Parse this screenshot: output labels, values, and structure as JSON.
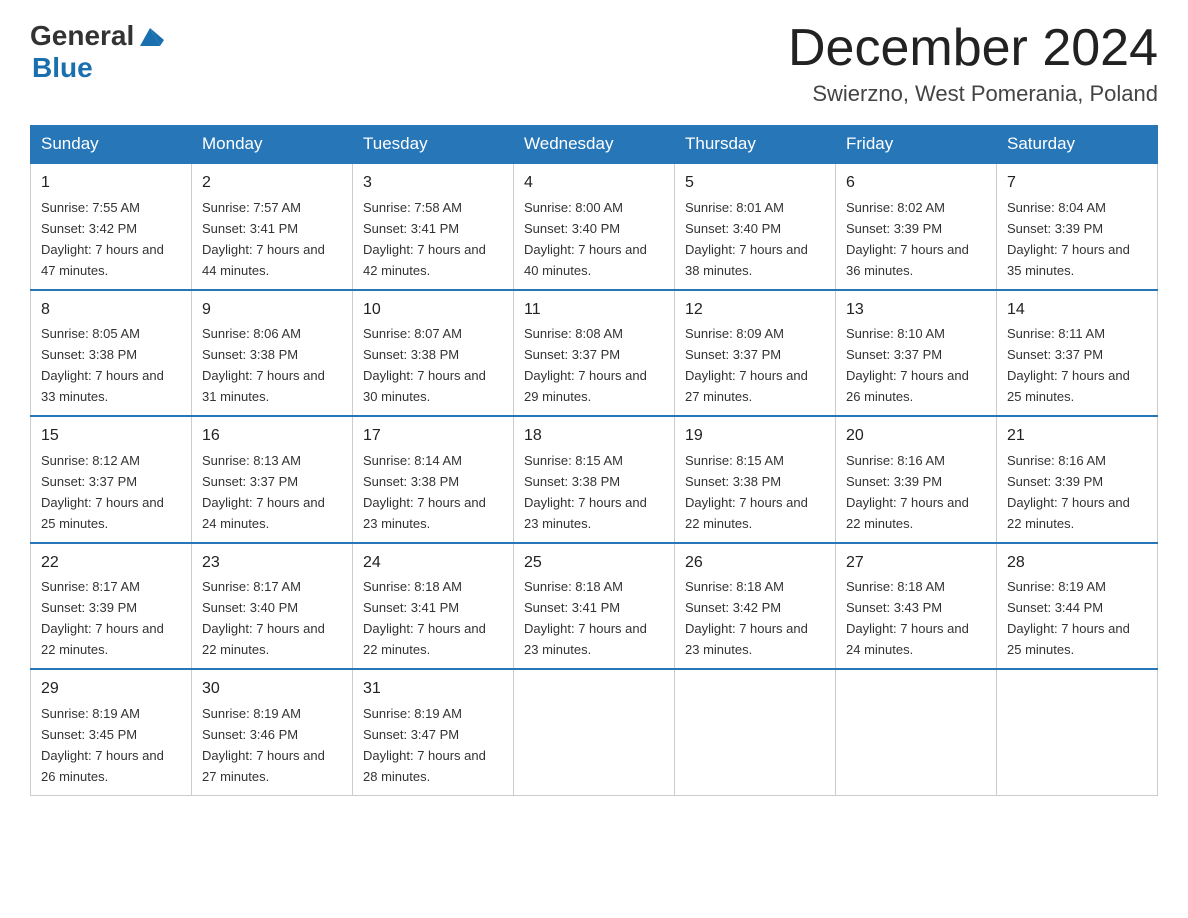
{
  "header": {
    "logo_general": "General",
    "logo_blue": "Blue",
    "month_title": "December 2024",
    "location": "Swierzno, West Pomerania, Poland"
  },
  "days_of_week": [
    "Sunday",
    "Monday",
    "Tuesday",
    "Wednesday",
    "Thursday",
    "Friday",
    "Saturday"
  ],
  "weeks": [
    [
      {
        "day": "1",
        "sunrise": "7:55 AM",
        "sunset": "3:42 PM",
        "daylight": "7 hours and 47 minutes."
      },
      {
        "day": "2",
        "sunrise": "7:57 AM",
        "sunset": "3:41 PM",
        "daylight": "7 hours and 44 minutes."
      },
      {
        "day": "3",
        "sunrise": "7:58 AM",
        "sunset": "3:41 PM",
        "daylight": "7 hours and 42 minutes."
      },
      {
        "day": "4",
        "sunrise": "8:00 AM",
        "sunset": "3:40 PM",
        "daylight": "7 hours and 40 minutes."
      },
      {
        "day": "5",
        "sunrise": "8:01 AM",
        "sunset": "3:40 PM",
        "daylight": "7 hours and 38 minutes."
      },
      {
        "day": "6",
        "sunrise": "8:02 AM",
        "sunset": "3:39 PM",
        "daylight": "7 hours and 36 minutes."
      },
      {
        "day": "7",
        "sunrise": "8:04 AM",
        "sunset": "3:39 PM",
        "daylight": "7 hours and 35 minutes."
      }
    ],
    [
      {
        "day": "8",
        "sunrise": "8:05 AM",
        "sunset": "3:38 PM",
        "daylight": "7 hours and 33 minutes."
      },
      {
        "day": "9",
        "sunrise": "8:06 AM",
        "sunset": "3:38 PM",
        "daylight": "7 hours and 31 minutes."
      },
      {
        "day": "10",
        "sunrise": "8:07 AM",
        "sunset": "3:38 PM",
        "daylight": "7 hours and 30 minutes."
      },
      {
        "day": "11",
        "sunrise": "8:08 AM",
        "sunset": "3:37 PM",
        "daylight": "7 hours and 29 minutes."
      },
      {
        "day": "12",
        "sunrise": "8:09 AM",
        "sunset": "3:37 PM",
        "daylight": "7 hours and 27 minutes."
      },
      {
        "day": "13",
        "sunrise": "8:10 AM",
        "sunset": "3:37 PM",
        "daylight": "7 hours and 26 minutes."
      },
      {
        "day": "14",
        "sunrise": "8:11 AM",
        "sunset": "3:37 PM",
        "daylight": "7 hours and 25 minutes."
      }
    ],
    [
      {
        "day": "15",
        "sunrise": "8:12 AM",
        "sunset": "3:37 PM",
        "daylight": "7 hours and 25 minutes."
      },
      {
        "day": "16",
        "sunrise": "8:13 AM",
        "sunset": "3:37 PM",
        "daylight": "7 hours and 24 minutes."
      },
      {
        "day": "17",
        "sunrise": "8:14 AM",
        "sunset": "3:38 PM",
        "daylight": "7 hours and 23 minutes."
      },
      {
        "day": "18",
        "sunrise": "8:15 AM",
        "sunset": "3:38 PM",
        "daylight": "7 hours and 23 minutes."
      },
      {
        "day": "19",
        "sunrise": "8:15 AM",
        "sunset": "3:38 PM",
        "daylight": "7 hours and 22 minutes."
      },
      {
        "day": "20",
        "sunrise": "8:16 AM",
        "sunset": "3:39 PM",
        "daylight": "7 hours and 22 minutes."
      },
      {
        "day": "21",
        "sunrise": "8:16 AM",
        "sunset": "3:39 PM",
        "daylight": "7 hours and 22 minutes."
      }
    ],
    [
      {
        "day": "22",
        "sunrise": "8:17 AM",
        "sunset": "3:39 PM",
        "daylight": "7 hours and 22 minutes."
      },
      {
        "day": "23",
        "sunrise": "8:17 AM",
        "sunset": "3:40 PM",
        "daylight": "7 hours and 22 minutes."
      },
      {
        "day": "24",
        "sunrise": "8:18 AM",
        "sunset": "3:41 PM",
        "daylight": "7 hours and 22 minutes."
      },
      {
        "day": "25",
        "sunrise": "8:18 AM",
        "sunset": "3:41 PM",
        "daylight": "7 hours and 23 minutes."
      },
      {
        "day": "26",
        "sunrise": "8:18 AM",
        "sunset": "3:42 PM",
        "daylight": "7 hours and 23 minutes."
      },
      {
        "day": "27",
        "sunrise": "8:18 AM",
        "sunset": "3:43 PM",
        "daylight": "7 hours and 24 minutes."
      },
      {
        "day": "28",
        "sunrise": "8:19 AM",
        "sunset": "3:44 PM",
        "daylight": "7 hours and 25 minutes."
      }
    ],
    [
      {
        "day": "29",
        "sunrise": "8:19 AM",
        "sunset": "3:45 PM",
        "daylight": "7 hours and 26 minutes."
      },
      {
        "day": "30",
        "sunrise": "8:19 AM",
        "sunset": "3:46 PM",
        "daylight": "7 hours and 27 minutes."
      },
      {
        "day": "31",
        "sunrise": "8:19 AM",
        "sunset": "3:47 PM",
        "daylight": "7 hours and 28 minutes."
      },
      null,
      null,
      null,
      null
    ]
  ]
}
